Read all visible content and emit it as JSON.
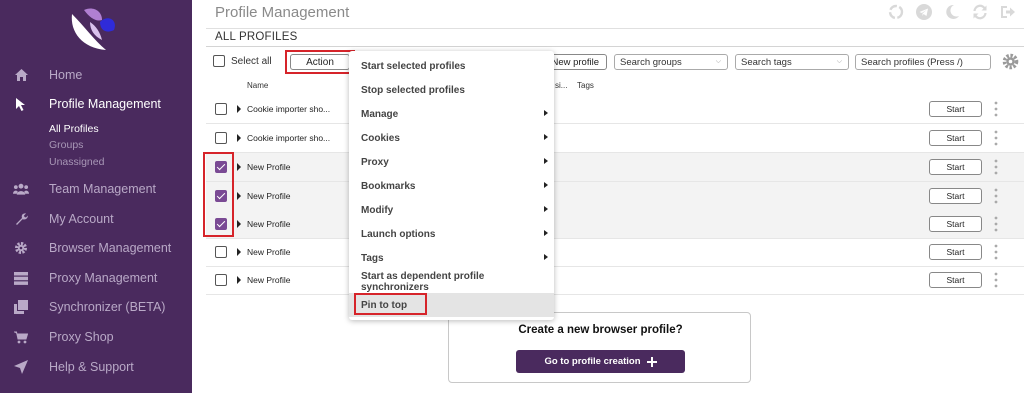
{
  "colors": {
    "sidebar_bg": "#4a2a5e",
    "accent": "#7a4a94",
    "highlight_box": "#d6242a",
    "primary_button": "#4a2a5e"
  },
  "sidebar": {
    "logo_icon": "butterfly-logo",
    "items": [
      {
        "label": "Home",
        "icon": "home-icon"
      },
      {
        "label": "Profile Management",
        "icon": "cursor-icon"
      },
      {
        "label": "Team Management",
        "icon": "users-icon"
      },
      {
        "label": "My Account",
        "icon": "wrench-icon"
      },
      {
        "label": "Browser Management",
        "icon": "gear-icon"
      },
      {
        "label": "Proxy Management",
        "icon": "server-icon"
      },
      {
        "label": "Synchronizer (BETA)",
        "icon": "copy-icon"
      },
      {
        "label": "Proxy Shop",
        "icon": "cart-icon"
      },
      {
        "label": "Help & Support",
        "icon": "send-icon"
      }
    ],
    "subitems": [
      "All Profiles",
      "Groups",
      "Unassigned"
    ]
  },
  "header": {
    "title": "Profile Management",
    "icons": [
      "recycle-icon",
      "telegram-icon",
      "moon-icon",
      "sync-icon",
      "logout-icon"
    ]
  },
  "section_title": "ALL PROFILES",
  "toolbar": {
    "select_all": "Select all",
    "action": "Action",
    "new_profile": "New profile",
    "search_groups": "Search groups",
    "search_tags": "Search tags",
    "search_profiles": "Search profiles (Press /)"
  },
  "columns": {
    "name": "Name",
    "si": "si...",
    "tags": "Tags"
  },
  "rows": [
    {
      "name": "Cookie importer sho...",
      "checked": false,
      "start": "Start"
    },
    {
      "name": "Cookie importer sho...",
      "checked": false,
      "start": "Start"
    },
    {
      "name": "New Profile",
      "checked": true,
      "start": "Start"
    },
    {
      "name": "New Profile",
      "checked": true,
      "start": "Start"
    },
    {
      "name": "New Profile",
      "checked": true,
      "start": "Start"
    },
    {
      "name": "New Profile",
      "checked": false,
      "start": "Start"
    },
    {
      "name": "New Profile",
      "checked": false,
      "start": "Start"
    }
  ],
  "menu": {
    "items": [
      {
        "label": "Start selected profiles",
        "submenu": false
      },
      {
        "label": "Stop selected profiles",
        "submenu": false
      },
      {
        "label": "Manage",
        "submenu": true
      },
      {
        "label": "Cookies",
        "submenu": true
      },
      {
        "label": "Proxy",
        "submenu": true
      },
      {
        "label": "Bookmarks",
        "submenu": true
      },
      {
        "label": "Modify",
        "submenu": true
      },
      {
        "label": "Launch options",
        "submenu": true
      },
      {
        "label": "Tags",
        "submenu": true
      },
      {
        "label": "Start as dependent profile synchronizers",
        "submenu": false
      },
      {
        "label": "Pin to top",
        "submenu": false,
        "highlighted": true
      }
    ]
  },
  "create": {
    "title": "Create a new browser profile?",
    "button": "Go to profile creation"
  }
}
